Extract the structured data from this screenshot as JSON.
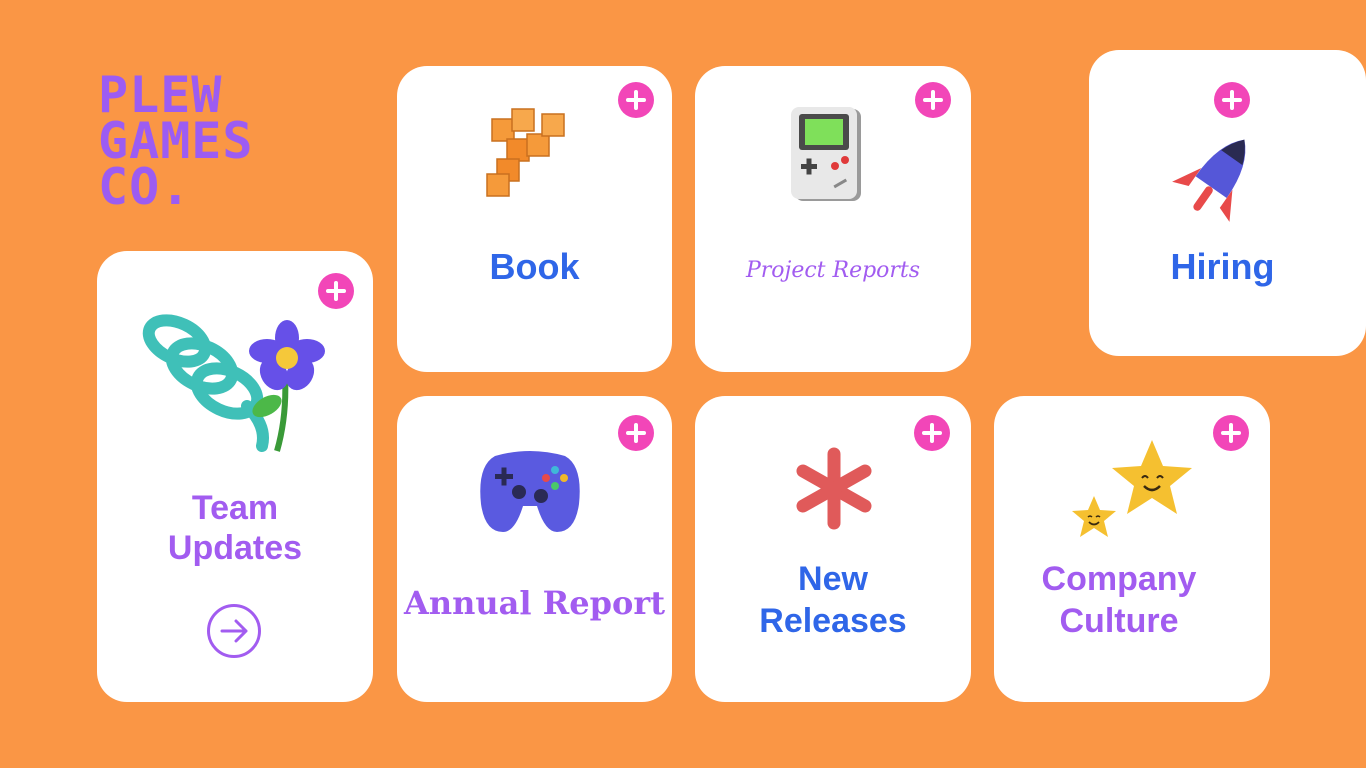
{
  "brand": {
    "lines": [
      "PLEW",
      "GAMES",
      "CO."
    ]
  },
  "cards": {
    "team_updates": {
      "title_line1": "Team",
      "title_line2": "Updates",
      "illustration": "spring-flower-icon",
      "arrow_icon": "arrow-right-icon"
    },
    "book": {
      "title": "Book",
      "illustration": "block-shape-icon"
    },
    "project_reports": {
      "title": "Project Reports",
      "illustration": "handheld-console-icon"
    },
    "hiring": {
      "title": "Hiring",
      "illustration": "rocket-icon"
    },
    "annual_report": {
      "title": "Annual Report",
      "illustration": "gamepad-icon"
    },
    "new_releases": {
      "title_line1": "New",
      "title_line2": "Releases",
      "illustration": "asterisk-icon"
    },
    "company_culture": {
      "title_line1": "Company",
      "title_line2": "Culture",
      "illustration": "smiling-stars-icon"
    }
  },
  "colors": {
    "background": "#fa9645",
    "card": "#ffffff",
    "plus_button": "#f246b8",
    "blue_text": "#2f66e8",
    "purple_text": "#a25cf0"
  }
}
